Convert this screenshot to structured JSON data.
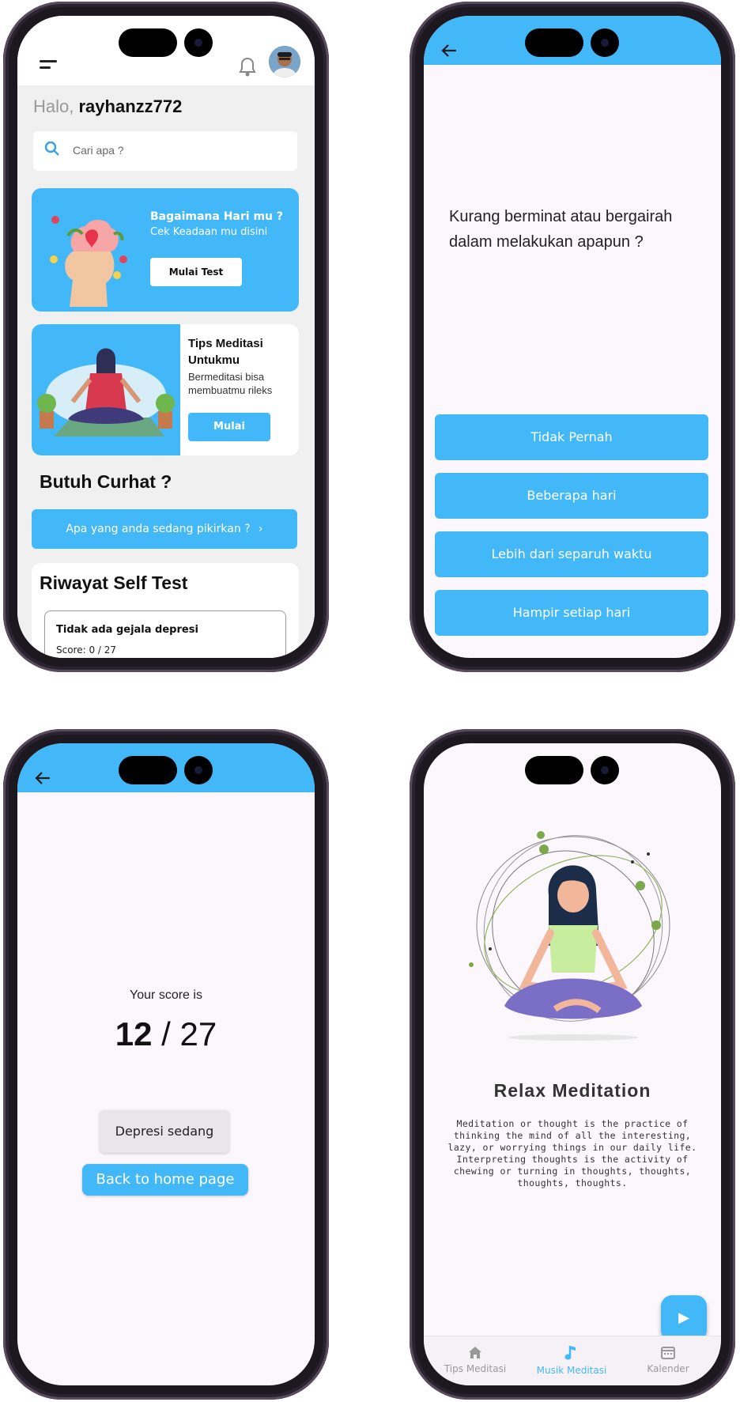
{
  "colors": {
    "accent": "#43b8f8",
    "background": "#fcf7fd"
  },
  "home": {
    "greeting_prefix": "Halo,",
    "username": "rayhanzz772",
    "search_placeholder": "Cari apa ?",
    "mood_card": {
      "title": "Bagaimana Hari mu ?",
      "subtitle": "Cek Keadaan mu disini",
      "button": "Mulai Test"
    },
    "meditation_card": {
      "title": "Tips Meditasi Untukmu",
      "subtitle": "Bermeditasi bisa membuatmu rileks",
      "button": "Mulai"
    },
    "curhat_title": "Butuh Curhat ?",
    "curhat_button": "Apa yang anda sedang pikirkan ?",
    "history_title": "Riwayat Self Test",
    "history_items": [
      {
        "result": "Tidak ada gejala depresi",
        "score": "Score: 0 / 27"
      }
    ],
    "icons": [
      "menu-icon",
      "bell-icon",
      "search-icon",
      "chevron-right-icon"
    ]
  },
  "quiz": {
    "question": "Kurang berminat atau bergairah dalam melakukan apapun ?",
    "answers": [
      "Tidak Pernah",
      "Beberapa hari",
      "Lebih dari separuh waktu",
      "Hampir setiap hari"
    ]
  },
  "result": {
    "label": "Your score is",
    "score": "12",
    "separator": " / ",
    "max": "27",
    "category": "Depresi sedang",
    "home_button": "Back to home page"
  },
  "meditation": {
    "title": "Relax Meditation",
    "description": "Meditation or thought is the practice of thinking the mind of all the interesting, lazy, or worrying things in our daily life. Interpreting thoughts is the activity of chewing or turning in thoughts, thoughts, thoughts, thoughts.",
    "nav": [
      {
        "label": "Tips Meditasi",
        "icon": "home-icon"
      },
      {
        "label": "Musik Meditasi",
        "icon": "music-note-icon"
      },
      {
        "label": "Kalender",
        "icon": "calendar-icon"
      }
    ],
    "active_nav": "Musik Meditasi"
  }
}
